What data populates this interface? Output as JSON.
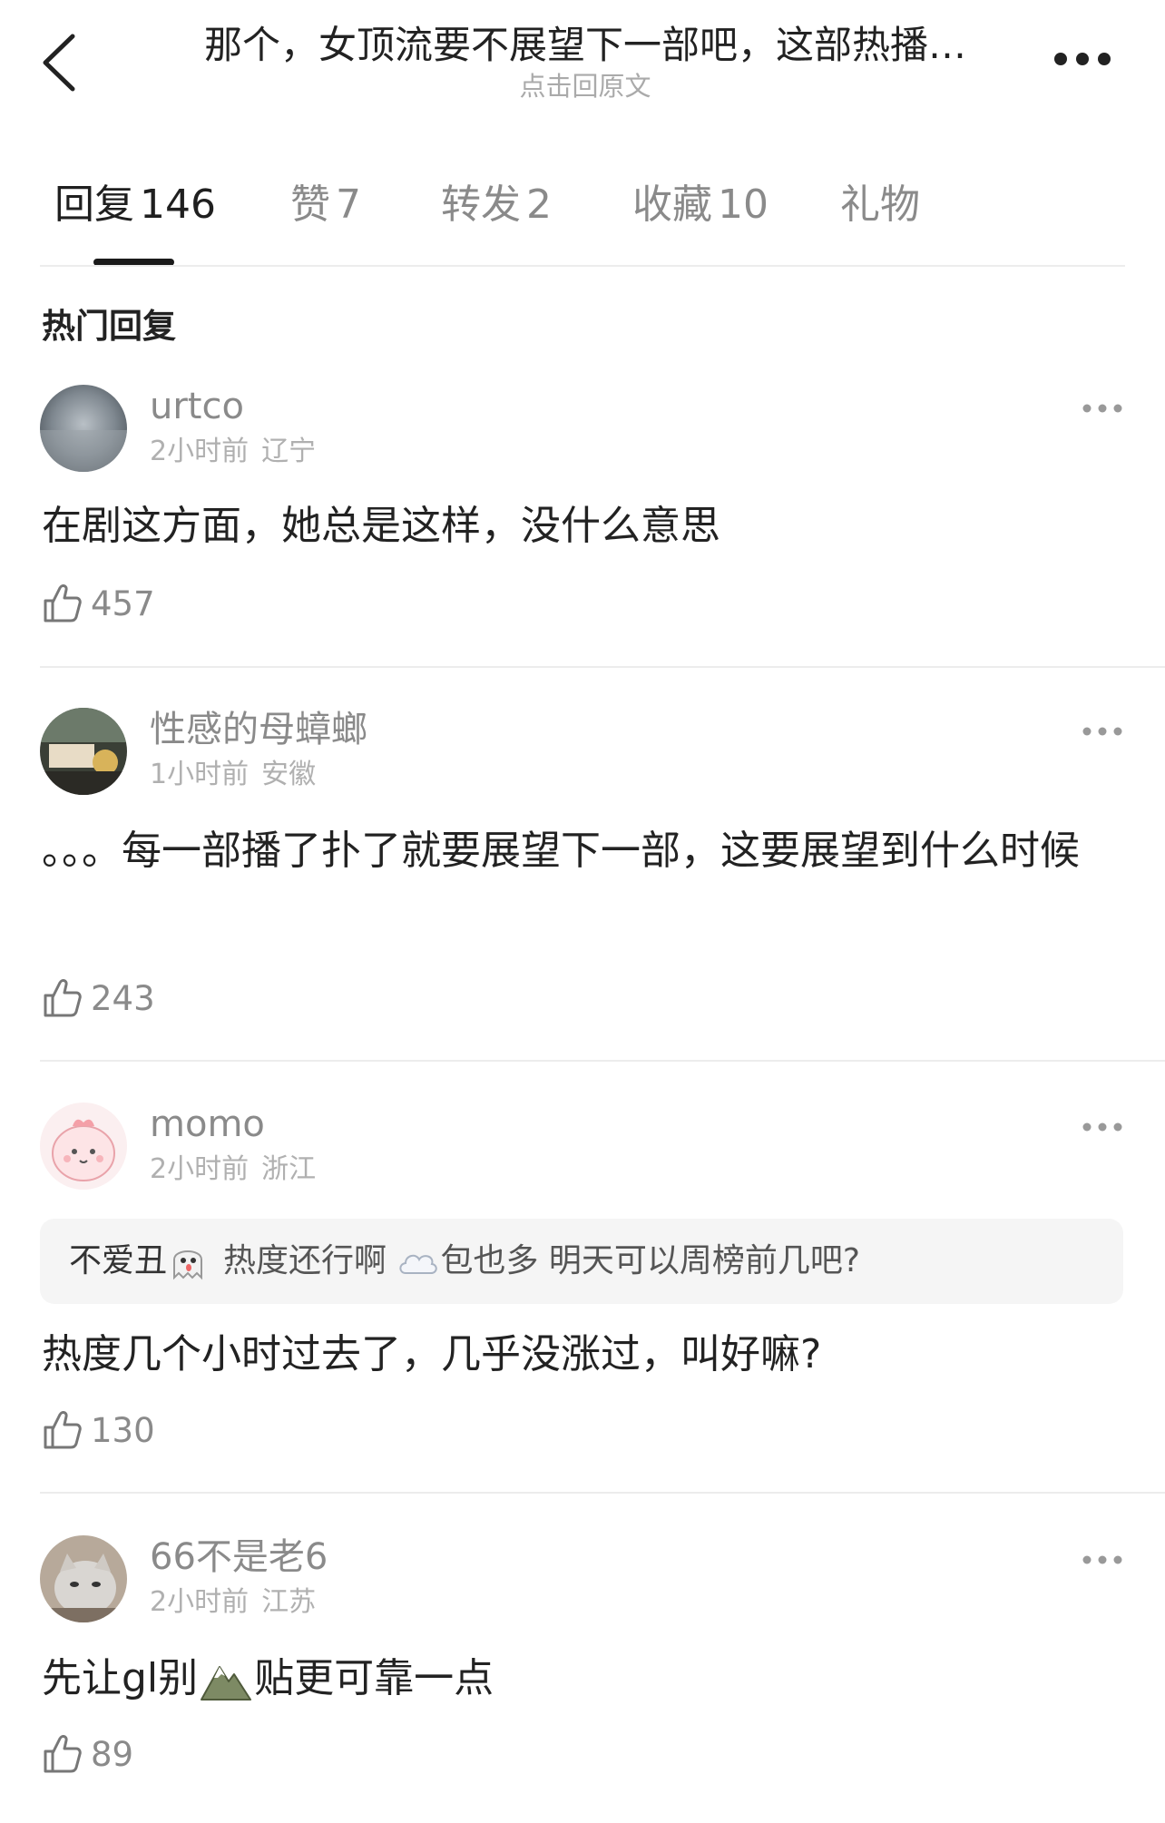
{
  "header": {
    "title": "那个，女顶流要不展望下一部吧，这部热播…",
    "subtitle": "点击回原文",
    "back_icon": "back-chevron-icon",
    "more_icon": "more-dots-icon"
  },
  "tabs": [
    {
      "label": "回复",
      "count": "146",
      "active": true
    },
    {
      "label": "赞",
      "count": "7"
    },
    {
      "label": "转发",
      "count": "2"
    },
    {
      "label": "收藏",
      "count": "10"
    },
    {
      "label": "礼物",
      "count": ""
    }
  ],
  "section_heading": "热门回复",
  "comments": [
    {
      "username": "urtco",
      "time": "2小时前",
      "location": "辽宁",
      "text": "在剧这方面，她总是这样，没什么意思",
      "likes": "457"
    },
    {
      "username": "性感的母蟑螂",
      "time": "1小时前",
      "location": "安徽",
      "text": "。。。每一部播了扑了就要展望下一部，这要展望到什么时候",
      "likes": "243"
    },
    {
      "username": "momo",
      "time": "2小时前",
      "location": "浙江",
      "quote": {
        "author": "不爱丑",
        "author_emoji": "ghost-emoji",
        "text_before_emoji": "热度还行啊",
        "text_emoji": "cloud-emoji",
        "text_after_emoji": "包也多 明天可以周榜前几吧?"
      },
      "text": "热度几个小时过去了，几乎没涨过，叫好嘛?",
      "likes": "130"
    },
    {
      "username": "66不是老6",
      "time": "2小时前",
      "location": "江苏",
      "text_before_emoji": "先让gl别",
      "text_emoji": "mountain-emoji",
      "text_after_emoji": "贴更可靠一点",
      "likes": "89"
    }
  ],
  "colors": {
    "text_primary": "#222222",
    "text_secondary": "#8a8a8a",
    "text_meta": "#b0b0b0",
    "divider": "#ececec",
    "quote_bg": "#f5f5f5"
  }
}
